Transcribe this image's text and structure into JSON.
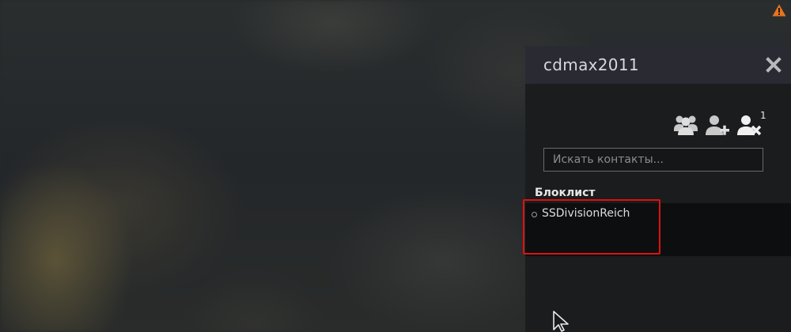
{
  "panel": {
    "username": "cdmax2011",
    "toolbar": {
      "icons": [
        "friends-group-icon",
        "add-friend-icon",
        "blocked-user-icon"
      ],
      "blocked_badge": "1"
    },
    "search": {
      "placeholder": "Искать контакты..."
    },
    "blocklist": {
      "label": "Блоклист",
      "items": [
        {
          "name": "SSDivisionReich",
          "status": "offline"
        }
      ]
    }
  },
  "colors": {
    "warning": "#e8741c",
    "highlight": "#e01010",
    "header_bg": "#2a2a33"
  }
}
